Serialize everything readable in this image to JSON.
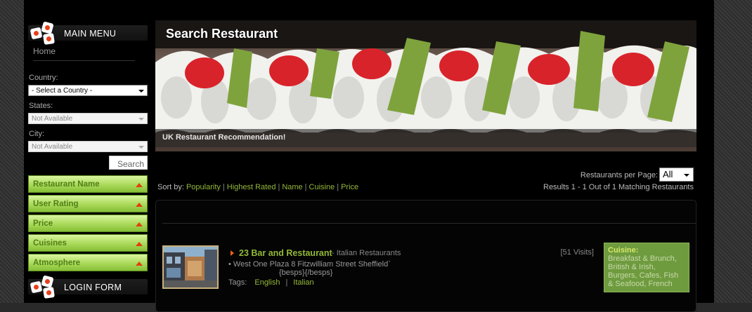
{
  "sidebar": {
    "main_menu_title": "MAIN MENU",
    "home_link": "Home",
    "country_label": "Country:",
    "country_value": "- Select a Country -",
    "states_label": "States:",
    "states_value": "Not Available",
    "city_label": "City:",
    "city_value": "Not Available",
    "search_button": "Search",
    "filters": [
      {
        "label": "Restaurant Name"
      },
      {
        "label": "User Rating"
      },
      {
        "label": "Price"
      },
      {
        "label": "Cuisines"
      },
      {
        "label": "Atmosphere"
      }
    ],
    "login_title": "LOGIN FORM"
  },
  "banner": {
    "title": "Search Restaurant",
    "caption": "UK Restaurant Recommendation!"
  },
  "controls": {
    "per_page_label": "Restaurants per Page:",
    "per_page_value": "All",
    "sort_label": "Sort by:",
    "sort_options": [
      "Popularity",
      "Highest Rated",
      "Name",
      "Cuisine",
      "Price"
    ],
    "results_text": "Results 1 - 1 Out of 1 Matching Restaurants"
  },
  "listing": {
    "name": "23 Bar and Restaurant",
    "type": "- Italian Restaurants",
    "address": "• West One Plaza 8 Fitzwilliam Street Sheffield`",
    "besps": "{besps}{/besps}",
    "tags_label": "Tags:",
    "tags": [
      "English",
      "Italian"
    ],
    "visits": "[51 Visits]",
    "cuisine_heading": "Cuisine:",
    "cuisine_text": "Breakfast & Brunch, British & Irish, Burgers, Cafes, Fish & Seafood, French"
  },
  "colors": {
    "accent_green": "#93b838",
    "filter_green": "#aad95a",
    "cuisine_box": "#6f9b3f",
    "arrow_orange": "#e8641a"
  }
}
